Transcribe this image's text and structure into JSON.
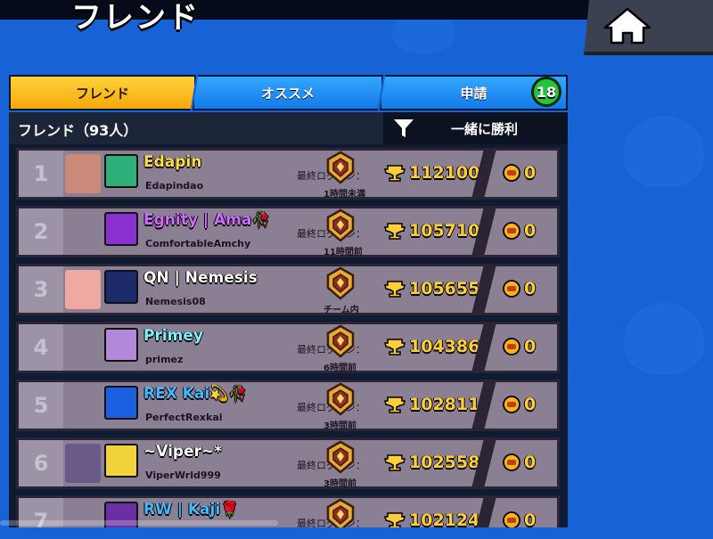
{
  "header": {
    "title": "フレンド",
    "home_icon": "home-icon"
  },
  "tabs": [
    {
      "label": "フレンド",
      "active": true
    },
    {
      "label": "オススメ",
      "active": false
    },
    {
      "label": "申請",
      "active": false,
      "badge": "18"
    }
  ],
  "subbar": {
    "friends_count": "フレンド（93人）",
    "filter_label": "一緒に勝利",
    "filter_icon": "filter-icon"
  },
  "friends": [
    {
      "rank": "1",
      "name": "Edapin",
      "tag": "Edapindao",
      "name_color": "#ffe04a",
      "last_login_label": "最終ログイン：",
      "time": "1時間未満",
      "trophies": "112100",
      "club_trophies": "0",
      "avatar1_color": "#c98a7a",
      "avatar2_color": "#2fb07a"
    },
    {
      "rank": "2",
      "name": "Egnity | Ama🥀",
      "tag": "ComfortableAmchy",
      "name_color": "#d16cff",
      "last_login_label": "最終ログイン：",
      "time": "11時間前",
      "trophies": "105710",
      "club_trophies": "0",
      "avatar1_color": "",
      "avatar2_color": "#8a2fd0"
    },
    {
      "rank": "3",
      "name": "QN | Nemesis",
      "tag": "Nemesis08",
      "name_color": "#ffffff",
      "last_login_label": "",
      "time": "チーム内",
      "trophies": "105655",
      "club_trophies": "0",
      "avatar1_color": "#f0a9a0",
      "avatar2_color": "#1d2b6a"
    },
    {
      "rank": "4",
      "name": "Primey",
      "tag": "primez",
      "name_color": "#7ff0ff",
      "last_login_label": "最終ログイン：",
      "time": "6時間前",
      "trophies": "104386",
      "club_trophies": "0",
      "avatar1_color": "",
      "avatar2_color": "#b08ad8"
    },
    {
      "rank": "5",
      "name": "REX Kai💫🥀",
      "tag": "PerfectRexkai",
      "name_color": "#4ab8ff",
      "last_login_label": "最終ログイン：",
      "time": "3時間前",
      "trophies": "102811",
      "club_trophies": "0",
      "avatar1_color": "",
      "avatar2_color": "#1a5fe0"
    },
    {
      "rank": "6",
      "name": "~Viper~*",
      "tag": "ViperWrld999",
      "name_color": "#ffffff",
      "last_login_label": "最終ログイン：",
      "time": "3時間前",
      "trophies": "102558",
      "club_trophies": "0",
      "avatar1_color": "#6a5a8a",
      "avatar2_color": "#f2d23a"
    },
    {
      "rank": "7",
      "name": "RW | Kaji🌹",
      "tag": "",
      "name_color": "#4ab8ff",
      "last_login_label": "最終ログイン：",
      "time": "",
      "trophies": "102124",
      "club_trophies": "0",
      "avatar1_color": "",
      "avatar2_color": "#6a2fa0"
    }
  ],
  "icons": {
    "trophy": "trophy-icon",
    "club": "club-trophy-icon",
    "rank": "rank-badge-icon"
  },
  "colors": {
    "background": "#1763d6",
    "tab_active": "#ffc21e",
    "tab_inactive": "#2196f3",
    "trophy_text": "#ffce3a",
    "badge": "#26c43a"
  }
}
